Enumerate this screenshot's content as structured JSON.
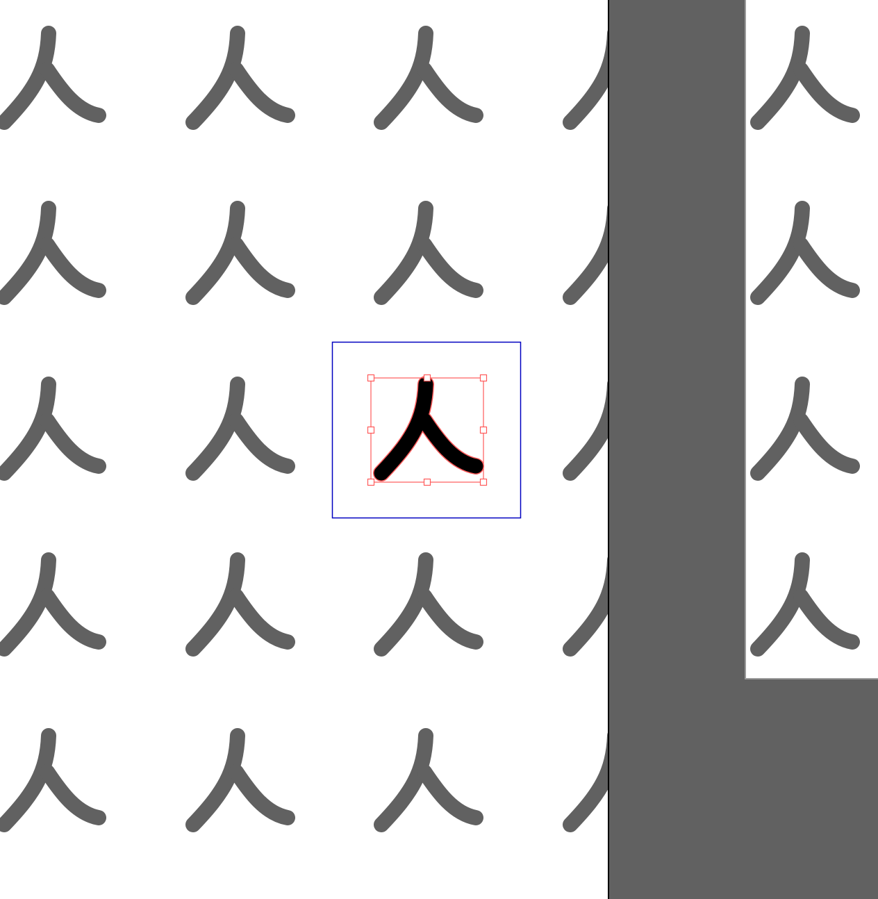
{
  "canvas": {
    "background": "#ffffff",
    "pattern": {
      "glyph": "person-radical",
      "color": "#616161",
      "columns_left_tile": 4,
      "columns_right_tile": 1,
      "rows": 5
    },
    "selected_glyph": {
      "glyph": "person-radical",
      "fill": "#000000",
      "outline_color": "#ff5a5a"
    },
    "cell_frame_color": "#0000c0",
    "handle_color": "#ff5a5a",
    "handle_count": 8
  },
  "panels": {
    "pasteboard_color": "#616161",
    "divider_color": "#000000",
    "adjacent_page_edge_color": "#9a9a9a"
  }
}
